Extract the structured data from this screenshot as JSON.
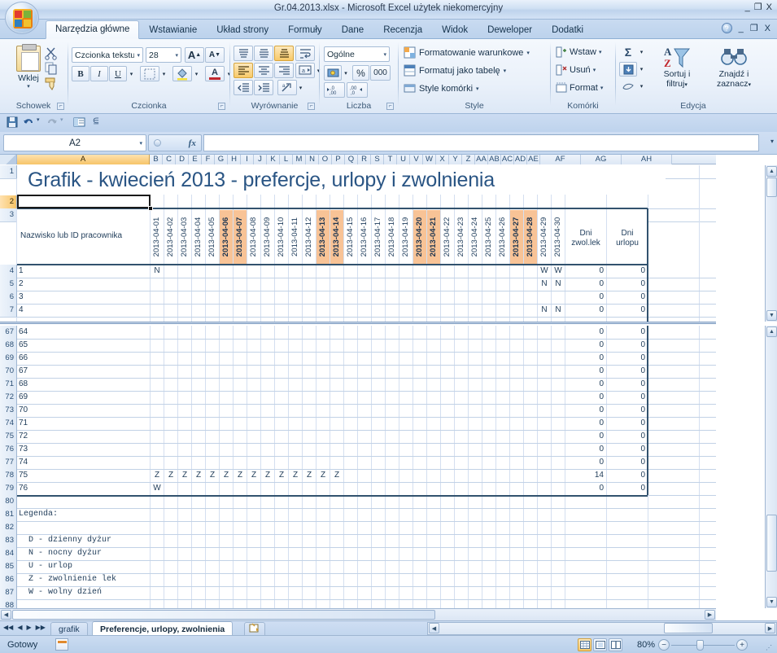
{
  "window": {
    "title": "Gr.04.2013.xlsx - Microsoft Excel użytek niekomercyjny",
    "minimize": "_",
    "maximize": "❐",
    "close": "X"
  },
  "ribbon": {
    "tabs": [
      {
        "label": "Narzędzia główne",
        "active": true
      },
      {
        "label": "Wstawianie",
        "active": false
      },
      {
        "label": "Układ strony",
        "active": false
      },
      {
        "label": "Formuły",
        "active": false
      },
      {
        "label": "Dane",
        "active": false
      },
      {
        "label": "Recenzja",
        "active": false
      },
      {
        "label": "Widok",
        "active": false
      },
      {
        "label": "Deweloper",
        "active": false
      },
      {
        "label": "Dodatki",
        "active": false
      }
    ],
    "help_label": "?",
    "ribbon_min": "_",
    "ribbon_restore": "❐",
    "ribbon_close": "X",
    "groups": {
      "clipboard": {
        "label": "Schowek",
        "paste_label": "Wklej",
        "paste_caret": "▾",
        "cut_icon": "scissors-icon",
        "copy_icon": "copy-icon",
        "format_painter_icon": "format-painter-icon"
      },
      "font": {
        "label": "Czcionka",
        "font_name": "Czcionka tekstu",
        "font_size": "28",
        "grow_font": "A",
        "shrink_font": "A",
        "bold": "B",
        "italic": "I",
        "underline": "U",
        "borders_icon": "borders-icon",
        "fill_color_icon": "fill-color-icon",
        "font_color": "A",
        "caret": "▾"
      },
      "alignment": {
        "label": "Wyrównanie",
        "align_top": "align-top-icon",
        "align_middle": "align-middle-icon",
        "align_bottom": "align-bottom-icon",
        "wrap_text": "wrap-text-icon",
        "align_left": "align-left-icon",
        "align_center": "align-center-icon",
        "align_right": "align-right-icon",
        "merge_center": "merge-center-icon",
        "decrease_indent": "decrease-indent-icon",
        "increase_indent": "increase-indent-icon",
        "orientation": "orientation-icon",
        "caret": "▾"
      },
      "number": {
        "label": "Liczba",
        "format": "Ogólne",
        "currency_icon": "currency-icon",
        "percent": "%",
        "comma": "000",
        "increase_decimal": "increase-decimal-icon",
        "decrease_decimal": "decrease-decimal-icon",
        "caret": "▾"
      },
      "styles": {
        "label": "Style",
        "items": [
          "Formatowanie warunkowe",
          "Formatuj jako tabelę",
          "Style komórki"
        ],
        "caret": "▾"
      },
      "cells": {
        "label": "Komórki",
        "items": [
          "Wstaw",
          "Usuń",
          "Format"
        ],
        "caret": "▾"
      },
      "editing": {
        "label": "Edycja",
        "autosum": "Σ",
        "fill": "▼",
        "clear": "clear-icon",
        "sort_filter": "Sortuj i\nfiltruj",
        "sort_filter_l1": "Sortuj i",
        "sort_filter_l2": "filtruj",
        "find_select_l1": "Znajdź i",
        "find_select_l2": "zaznacz",
        "caret": "▾"
      }
    }
  },
  "qat": {
    "save_icon": "save-icon",
    "undo_icon": "undo-icon",
    "redo_icon": "redo-icon",
    "print_preview_icon": "print-preview-icon",
    "customize_icon": "customize-qat-icon"
  },
  "formula_bar": {
    "name_box": "A2",
    "name_box_caret": "▾",
    "cancel_icon": "cancel-icon",
    "enter_icon": "enter-icon",
    "function_icon": "fx",
    "formula_value": "",
    "expand_caret": "▾"
  },
  "grid": {
    "columns": [
      {
        "name": "A",
        "width": 163,
        "active": true
      },
      {
        "name": "B",
        "width": 16
      },
      {
        "name": "C",
        "width": 16
      },
      {
        "name": "D",
        "width": 16
      },
      {
        "name": "E",
        "width": 16
      },
      {
        "name": "F",
        "width": 16
      },
      {
        "name": "G",
        "width": 16
      },
      {
        "name": "H",
        "width": 16
      },
      {
        "name": "I",
        "width": 16
      },
      {
        "name": "J",
        "width": 16
      },
      {
        "name": "K",
        "width": 16
      },
      {
        "name": "L",
        "width": 16
      },
      {
        "name": "M",
        "width": 16
      },
      {
        "name": "N",
        "width": 16
      },
      {
        "name": "O",
        "width": 16
      },
      {
        "name": "P",
        "width": 16
      },
      {
        "name": "Q",
        "width": 16
      },
      {
        "name": "R",
        "width": 16
      },
      {
        "name": "S",
        "width": 16
      },
      {
        "name": "T",
        "width": 16
      },
      {
        "name": "U",
        "width": 16
      },
      {
        "name": "V",
        "width": 16
      },
      {
        "name": "W",
        "width": 16
      },
      {
        "name": "X",
        "width": 16
      },
      {
        "name": "Y",
        "width": 16
      },
      {
        "name": "Z",
        "width": 16
      },
      {
        "name": "AA",
        "width": 16
      },
      {
        "name": "AB",
        "width": 16
      },
      {
        "name": "AC",
        "width": 16
      },
      {
        "name": "AD",
        "width": 16
      },
      {
        "name": "AE",
        "width": 16
      },
      {
        "name": "AF",
        "width": 50
      },
      {
        "name": "AG",
        "width": 50
      },
      {
        "name": "AH",
        "width": 62
      }
    ],
    "title_cell": "Grafik - kwiecień 2013 - prefercje, urlopy i zwolnienia",
    "header_name_col": "Nazwisko lub ID pracownika",
    "header_sick": "Dni\nzwol.lek",
    "header_sick_l1": "Dni",
    "header_sick_l2": "zwol.lek",
    "header_vac": "Dni\nurlopu",
    "header_vac_l1": "Dni",
    "header_vac_l2": "urlopu",
    "dates": [
      {
        "label": "2013-04-01",
        "weekend": false
      },
      {
        "label": "2013-04-02",
        "weekend": false
      },
      {
        "label": "2013-04-03",
        "weekend": false
      },
      {
        "label": "2013-04-04",
        "weekend": false
      },
      {
        "label": "2013-04-05",
        "weekend": false
      },
      {
        "label": "2013-04-06",
        "weekend": true
      },
      {
        "label": "2013-04-07",
        "weekend": true
      },
      {
        "label": "2013-04-08",
        "weekend": false
      },
      {
        "label": "2013-04-09",
        "weekend": false
      },
      {
        "label": "2013-04-10",
        "weekend": false
      },
      {
        "label": "2013-04-11",
        "weekend": false
      },
      {
        "label": "2013-04-12",
        "weekend": false
      },
      {
        "label": "2013-04-13",
        "weekend": true
      },
      {
        "label": "2013-04-14",
        "weekend": true
      },
      {
        "label": "2013-04-15",
        "weekend": false
      },
      {
        "label": "2013-04-16",
        "weekend": false
      },
      {
        "label": "2013-04-17",
        "weekend": false
      },
      {
        "label": "2013-04-18",
        "weekend": false
      },
      {
        "label": "2013-04-19",
        "weekend": false
      },
      {
        "label": "2013-04-20",
        "weekend": true
      },
      {
        "label": "2013-04-21",
        "weekend": true
      },
      {
        "label": "2013-04-22",
        "weekend": false
      },
      {
        "label": "2013-04-23",
        "weekend": false
      },
      {
        "label": "2013-04-24",
        "weekend": false
      },
      {
        "label": "2013-04-25",
        "weekend": false
      },
      {
        "label": "2013-04-26",
        "weekend": false
      },
      {
        "label": "2013-04-27",
        "weekend": true
      },
      {
        "label": "2013-04-28",
        "weekend": true
      },
      {
        "label": "2013-04-29",
        "weekend": false
      },
      {
        "label": "2013-04-30",
        "weekend": false
      }
    ],
    "top_pane_rows": [
      {
        "row": 4,
        "name": "1",
        "marks": {
          "0": "N",
          "28": "W",
          "29": "W"
        },
        "sick": "0",
        "vac": "0"
      },
      {
        "row": 5,
        "name": "2",
        "marks": {
          "28": "N",
          "29": "N"
        },
        "sick": "0",
        "vac": "0"
      },
      {
        "row": 6,
        "name": "3",
        "marks": {},
        "sick": "0",
        "vac": "0"
      },
      {
        "row": 7,
        "name": "4",
        "marks": {
          "28": "N",
          "29": "N"
        },
        "sick": "0",
        "vac": "0"
      }
    ],
    "bottom_pane_rows": [
      {
        "row": 67,
        "name": "64",
        "marks": {},
        "sick": "0",
        "vac": "0"
      },
      {
        "row": 68,
        "name": "65",
        "marks": {},
        "sick": "0",
        "vac": "0"
      },
      {
        "row": 69,
        "name": "66",
        "marks": {},
        "sick": "0",
        "vac": "0"
      },
      {
        "row": 70,
        "name": "67",
        "marks": {},
        "sick": "0",
        "vac": "0"
      },
      {
        "row": 71,
        "name": "68",
        "marks": {},
        "sick": "0",
        "vac": "0"
      },
      {
        "row": 72,
        "name": "69",
        "marks": {},
        "sick": "0",
        "vac": "0"
      },
      {
        "row": 73,
        "name": "70",
        "marks": {},
        "sick": "0",
        "vac": "0"
      },
      {
        "row": 74,
        "name": "71",
        "marks": {},
        "sick": "0",
        "vac": "0"
      },
      {
        "row": 75,
        "name": "72",
        "marks": {},
        "sick": "0",
        "vac": "0"
      },
      {
        "row": 76,
        "name": "73",
        "marks": {},
        "sick": "0",
        "vac": "0"
      },
      {
        "row": 77,
        "name": "74",
        "marks": {},
        "sick": "0",
        "vac": "0"
      },
      {
        "row": 78,
        "name": "75",
        "marks": {
          "0": "Z",
          "1": "Z",
          "2": "Z",
          "3": "Z",
          "4": "Z",
          "5": "Z",
          "6": "Z",
          "7": "Z",
          "8": "Z",
          "9": "Z",
          "10": "Z",
          "11": "Z",
          "12": "Z",
          "13": "Z"
        },
        "sick": "14",
        "vac": "0"
      },
      {
        "row": 79,
        "name": "76",
        "marks": {
          "0": "W"
        },
        "sick": "0",
        "vac": "0"
      }
    ],
    "legend_rows": [
      {
        "row": 80,
        "text": ""
      },
      {
        "row": 81,
        "text": "Legenda:"
      },
      {
        "row": 82,
        "text": ""
      },
      {
        "row": 83,
        "text": "  D - dzienny dyżur"
      },
      {
        "row": 84,
        "text": "  N - nocny dyżur"
      },
      {
        "row": 85,
        "text": "  U - urlop"
      },
      {
        "row": 86,
        "text": "  Z - zwolnienie lek"
      },
      {
        "row": 87,
        "text": "  W - wolny dzień"
      },
      {
        "row": 88,
        "text": ""
      },
      {
        "row": 89,
        "text": ""
      },
      {
        "row": 90,
        "text": ""
      }
    ],
    "selected_cell": "A2",
    "weekend_fill": "#f8c396",
    "header_text_color": "#1f3d5c",
    "title_color": "#2a5584"
  },
  "sheet_tabs": {
    "nav_first": "◀◀",
    "nav_prev": "◀",
    "nav_next": "▶",
    "nav_last": "▶▶",
    "tabs": [
      {
        "label": "grafik",
        "active": false
      },
      {
        "label": "Preferencje, urlopy, zwolnienia",
        "active": true
      }
    ],
    "new_sheet_icon": "new-sheet-icon"
  },
  "status_bar": {
    "status": "Gotowy",
    "macro_icon": "record-macro-icon",
    "view_normal": "normal-view-icon",
    "view_layout": "page-layout-view-icon",
    "view_break": "page-break-view-icon",
    "zoom": "80%",
    "zoom_out": "−",
    "zoom_in": "+",
    "resize_grip": "resize-grip-icon"
  }
}
